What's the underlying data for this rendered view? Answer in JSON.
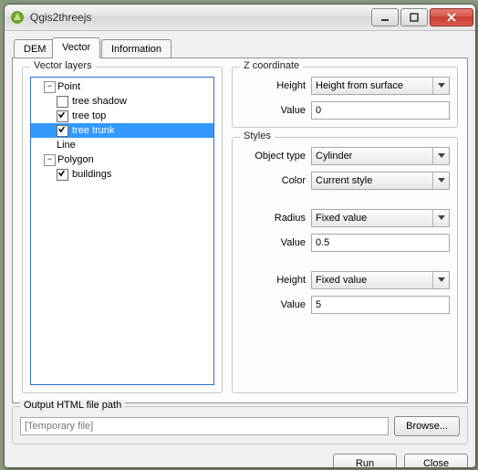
{
  "window": {
    "title": "Qgis2threejs"
  },
  "tabs": {
    "dem": "DEM",
    "vector": "Vector",
    "information": "Information"
  },
  "tree": {
    "legend": "Vector layers",
    "point": "Point",
    "tree_shadow": "tree shadow",
    "tree_top": "tree top",
    "tree_trunk": "tree trunk",
    "line": "Line",
    "polygon": "Polygon",
    "buildings": "buildings"
  },
  "z": {
    "legend": "Z coordinate",
    "height_label": "Height",
    "height_value": "Height from surface",
    "value_label": "Value",
    "value_value": "0"
  },
  "styles": {
    "legend": "Styles",
    "object_type_label": "Object type",
    "object_type_value": "Cylinder",
    "color_label": "Color",
    "color_value": "Current style",
    "radius_label": "Radius",
    "radius_mode": "Fixed value",
    "radius_value_label": "Value",
    "radius_value": "0.5",
    "height_label": "Height",
    "height_mode": "Fixed value",
    "height_value_label": "Value",
    "height_value": "5"
  },
  "output": {
    "legend": "Output HTML file path",
    "placeholder": "[Temporary file]",
    "browse": "Browse..."
  },
  "buttons": {
    "run": "Run",
    "close": "Close"
  }
}
